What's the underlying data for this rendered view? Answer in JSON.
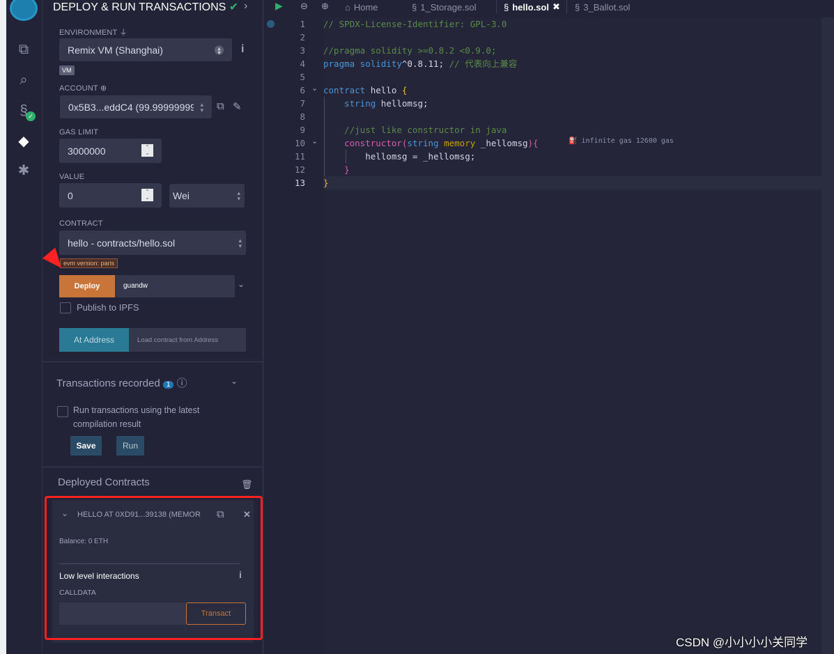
{
  "panel": {
    "title": "DEPLOY & RUN TRANSACTIONS",
    "environment": {
      "label": "ENVIRONMENT",
      "value": "Remix VM (Shanghai)",
      "badge": "VM"
    },
    "account": {
      "label": "ACCOUNT",
      "value": "0x5B3...eddC4 (99.99999999"
    },
    "gas_limit": {
      "label": "GAS LIMIT",
      "value": "3000000"
    },
    "value": {
      "label": "VALUE",
      "amount": "0",
      "unit": "Wei"
    },
    "contract": {
      "label": "CONTRACT",
      "value": "hello - contracts/hello.sol",
      "evm_badge": "evm version: paris"
    },
    "deploy": {
      "button": "Deploy",
      "arg": "guandw"
    },
    "publish_ipfs": "Publish to IPFS",
    "at_address": {
      "button": "At Address",
      "placeholder": "Load contract from Address"
    },
    "transactions": {
      "title": "Transactions recorded",
      "count": "1",
      "checkbox": "Run transactions using the latest compilation result",
      "save": "Save",
      "run": "Run"
    },
    "deployed": {
      "title": "Deployed Contracts",
      "instance": {
        "name": "HELLO AT 0XD91...39138 (MEMOR",
        "balance": "Balance: 0 ETH",
        "low_level": "Low level interactions",
        "calldata_label": "CALLDATA",
        "transact": "Transact"
      }
    }
  },
  "editor": {
    "tabs": [
      "Home",
      "1_Storage.sol",
      "hello.sol",
      "3_Ballot.sol"
    ],
    "active_tab": "hello.sol",
    "gas_hint": "infinite gas 12600 gas",
    "lines": [
      [
        [
          "cm",
          "// SPDX-License-Identifier: GPL-3.0"
        ]
      ],
      [],
      [
        [
          "cm",
          "//pragma solidity >=0.8.2 <0.9.0;"
        ]
      ],
      [
        [
          "kw",
          "pragma solidity"
        ],
        [
          "pl",
          "^0.8.11; "
        ],
        [
          "cm",
          "// 代表向上兼容"
        ]
      ],
      [],
      [
        [
          "kw",
          "contract "
        ],
        [
          "pl",
          "hello "
        ],
        [
          "br",
          "{"
        ]
      ],
      [
        [
          "pl",
          "    "
        ],
        [
          "kw",
          "string "
        ],
        [
          "pl",
          "hellomsg;"
        ]
      ],
      [],
      [
        [
          "cm",
          "    //just like constructor in java"
        ]
      ],
      [
        [
          "pl",
          "    "
        ],
        [
          "pk",
          "constructor("
        ],
        [
          "kw",
          "string "
        ],
        [
          "yl",
          "memory "
        ],
        [
          "pl",
          "_hellomsg"
        ],
        [
          "pk",
          "){"
        ]
      ],
      [
        [
          "pl",
          "        hellomsg = _hellomsg;"
        ]
      ],
      [
        [
          "pk",
          "    }"
        ]
      ],
      [
        [
          "br",
          "}"
        ]
      ]
    ]
  },
  "watermark": "CSDN @小小小小关同学",
  "colors": {
    "accent_orange": "#c97539",
    "accent_teal": "#2a7a95",
    "highlight_red": "#ff2020",
    "bg": "#222336"
  }
}
